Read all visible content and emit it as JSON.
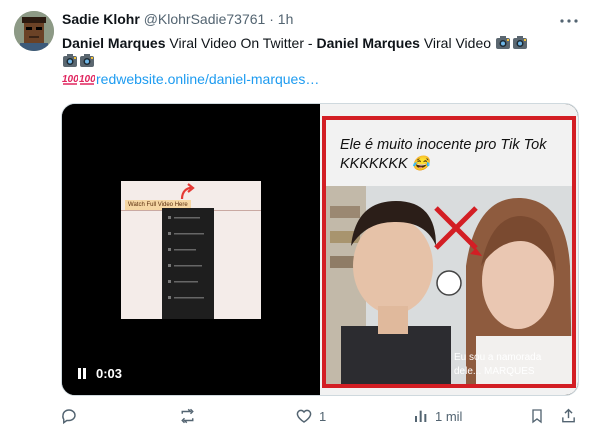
{
  "user": {
    "display_name": "Sadie Klohr",
    "handle": "@KlohrSadie73761",
    "separator": "·",
    "time": "1h"
  },
  "tweet": {
    "bold_1": "Daniel Marques",
    "text_1": " Viral Video On Twitter - ",
    "bold_2": "Daniel Marques",
    "text_2": " Viral Video ",
    "link": "redwebsite.online/daniel-marques…"
  },
  "media": {
    "video": {
      "timestamp": "0:03",
      "thumbnail_label": "Watch Full Video Here"
    },
    "image": {
      "caption": "Ele é muito inocente pro Tik Tok KKKKKKK 😂",
      "overlay_text_1": "Eu sou a namorada",
      "overlay_text_2": "dele... MARQUES"
    }
  },
  "actions": {
    "reply_count": "",
    "retweet_count": "",
    "like_count": "1",
    "views_count": "1 mil"
  },
  "colors": {
    "link": "#1d9bf0",
    "muted": "#536471",
    "frame_red": "#d31e24"
  },
  "icons": [
    "camera-emoji",
    "hundred-emoji",
    "pause-icon",
    "reply-icon",
    "retweet-icon",
    "like-icon",
    "views-icon",
    "bookmark-icon",
    "share-icon",
    "more-icon"
  ]
}
